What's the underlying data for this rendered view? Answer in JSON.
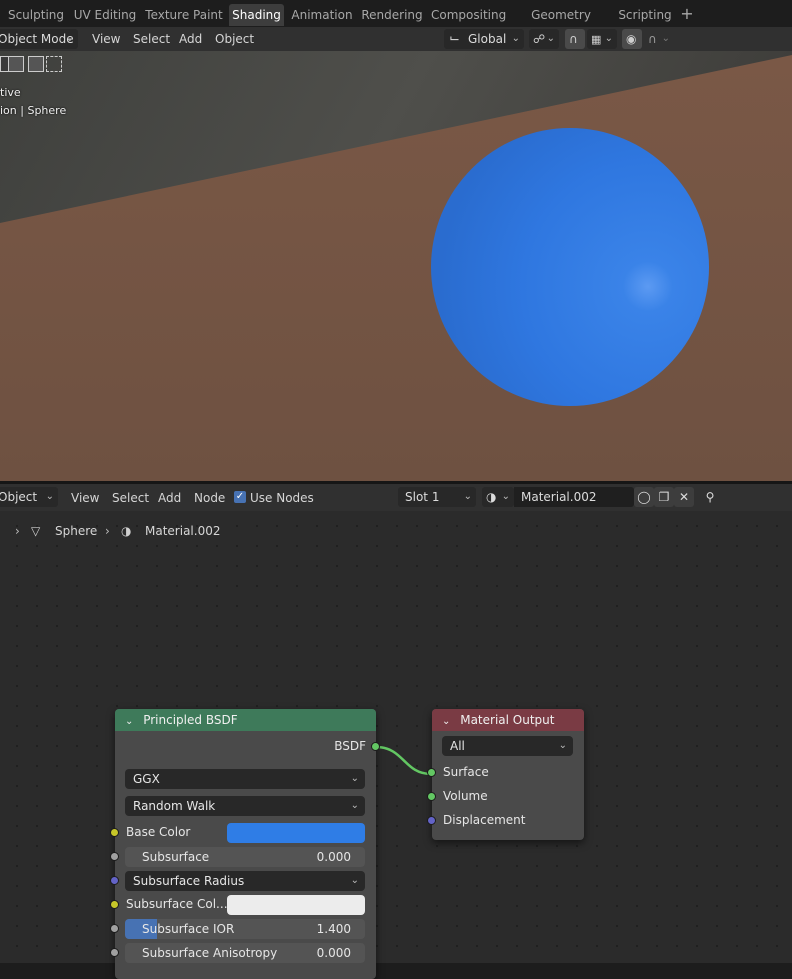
{
  "workspace_tabs": [
    {
      "label": "Sculpting",
      "active": false
    },
    {
      "label": "UV Editing",
      "active": false
    },
    {
      "label": "Texture Paint",
      "active": false
    },
    {
      "label": "Shading",
      "active": true
    },
    {
      "label": "Animation",
      "active": false
    },
    {
      "label": "Rendering",
      "active": false
    },
    {
      "label": "Compositing",
      "active": false
    },
    {
      "label": "Geometry Nodes",
      "active": false
    },
    {
      "label": "Scripting",
      "active": false
    }
  ],
  "add_workspace_label": "+",
  "viewport_header": {
    "mode": "Object Mode",
    "menu": [
      "View",
      "Select",
      "Add",
      "Object"
    ],
    "transform_orientation": "Global"
  },
  "viewport_overlay": {
    "line1": "tive",
    "line2": "ion | Sphere"
  },
  "node_header": {
    "editor_type": "Object",
    "menu": [
      "View",
      "Select",
      "Add",
      "Node"
    ],
    "use_nodes_label": "Use Nodes",
    "use_nodes_checked": true,
    "slot": "Slot 1",
    "material": "Material.002"
  },
  "breadcrumb": {
    "object": "Sphere",
    "material": "Material.002"
  },
  "principled_node": {
    "title": "Principled BSDF",
    "output_label": "BSDF",
    "distribution": "GGX",
    "subsurface_method": "Random Walk",
    "base_color_label": "Base Color",
    "base_color": "#2f7de6",
    "subsurface_label": "Subsurface",
    "subsurface_value": "0.000",
    "subsurface_radius_label": "Subsurface Radius",
    "subsurface_color_label": "Subsurface Col...",
    "subsurface_color": "#ececec",
    "subsurface_ior_label": "Subsurface IOR",
    "subsurface_ior_value": "1.400",
    "subsurface_anisotropy_label": "Subsurface Anisotropy",
    "subsurface_anisotropy_value": "0.000"
  },
  "output_node": {
    "title": "Material Output",
    "target": "All",
    "inputs": [
      "Surface",
      "Volume",
      "Displacement"
    ]
  },
  "colors": {
    "sphere": "#2f77e0",
    "floor": "#7a5846",
    "principled_header": "#3e7a5a",
    "output_header": "#7a3b44",
    "link": "#63c763"
  }
}
